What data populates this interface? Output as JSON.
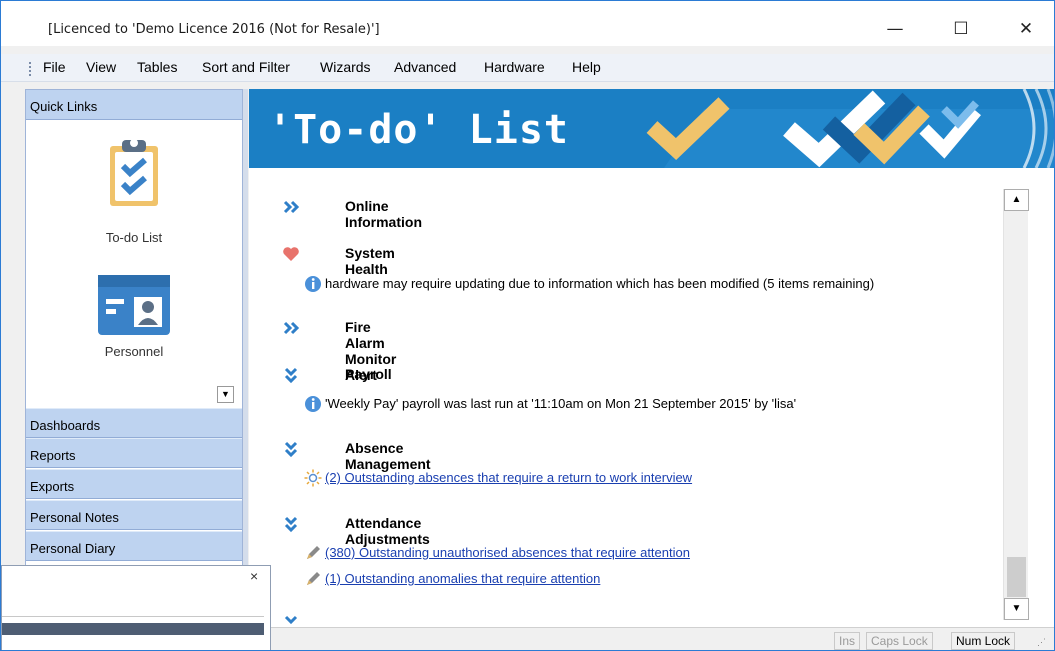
{
  "window": {
    "title": "[Licenced to 'Demo Licence 2016 (Not for Resale)']",
    "controls": {
      "minimize": "—",
      "maximize": "☐",
      "close": "✕"
    }
  },
  "menu": [
    {
      "label": "File"
    },
    {
      "label": "View"
    },
    {
      "label": "Tables"
    },
    {
      "label": "Sort and Filter"
    },
    {
      "label": "Wizards"
    },
    {
      "label": "Advanced"
    },
    {
      "label": "Hardware"
    },
    {
      "label": "Help"
    }
  ],
  "sidebar": {
    "quick_links_header": "Quick Links",
    "quick_links": [
      {
        "label": "To-do List",
        "icon": "clipboard-check-icon"
      },
      {
        "label": "Personnel",
        "icon": "id-card-icon"
      }
    ],
    "nav": [
      "Dashboards",
      "Reports",
      "Exports",
      "Personal Notes",
      "Personal Diary"
    ]
  },
  "banner": {
    "title": "'To-do' List"
  },
  "sections": [
    {
      "title": "Online Information",
      "icon": "double-chevron-right-icon",
      "lines": []
    },
    {
      "title": "System Health",
      "icon": "heart-icon",
      "lines": [
        {
          "icon": "info-icon",
          "text": "hardware may require updating due to information which has been modified (5 items remaining)",
          "link": false
        }
      ]
    },
    {
      "title": "Fire Alarm Monitor Alert",
      "icon": "double-chevron-right-icon",
      "lines": []
    },
    {
      "title": "Payroll",
      "icon": "double-chevron-down-icon",
      "lines": [
        {
          "icon": "info-icon",
          "text": "'Weekly Pay' payroll was last run at '11:10am on Mon 21 September 2015' by 'lisa'",
          "link": false
        }
      ]
    },
    {
      "title": "Absence Management",
      "icon": "double-chevron-down-icon",
      "lines": [
        {
          "icon": "sun-icon",
          "text": "(2) Outstanding absences that require a return to work interview",
          "link": true
        }
      ]
    },
    {
      "title": "Attendance Adjustments",
      "icon": "double-chevron-down-icon",
      "lines": [
        {
          "icon": "pencil-icon",
          "text": "(380) Outstanding unauthorised absences that require attention",
          "link": true
        },
        {
          "icon": "pencil-icon",
          "text": "(1) Outstanding anomalies that require attention",
          "link": true
        }
      ]
    }
  ],
  "status": {
    "ins": "Ins",
    "caps": "Caps Lock",
    "num": "Num Lock"
  },
  "popup": {
    "close": "×"
  },
  "colors": {
    "banner_blue": "#1b7fc4",
    "check_gold": "#f0c36b",
    "link": "#1a3fb0",
    "nav_bg": "#bed3f0",
    "heart": "#e8736c"
  }
}
